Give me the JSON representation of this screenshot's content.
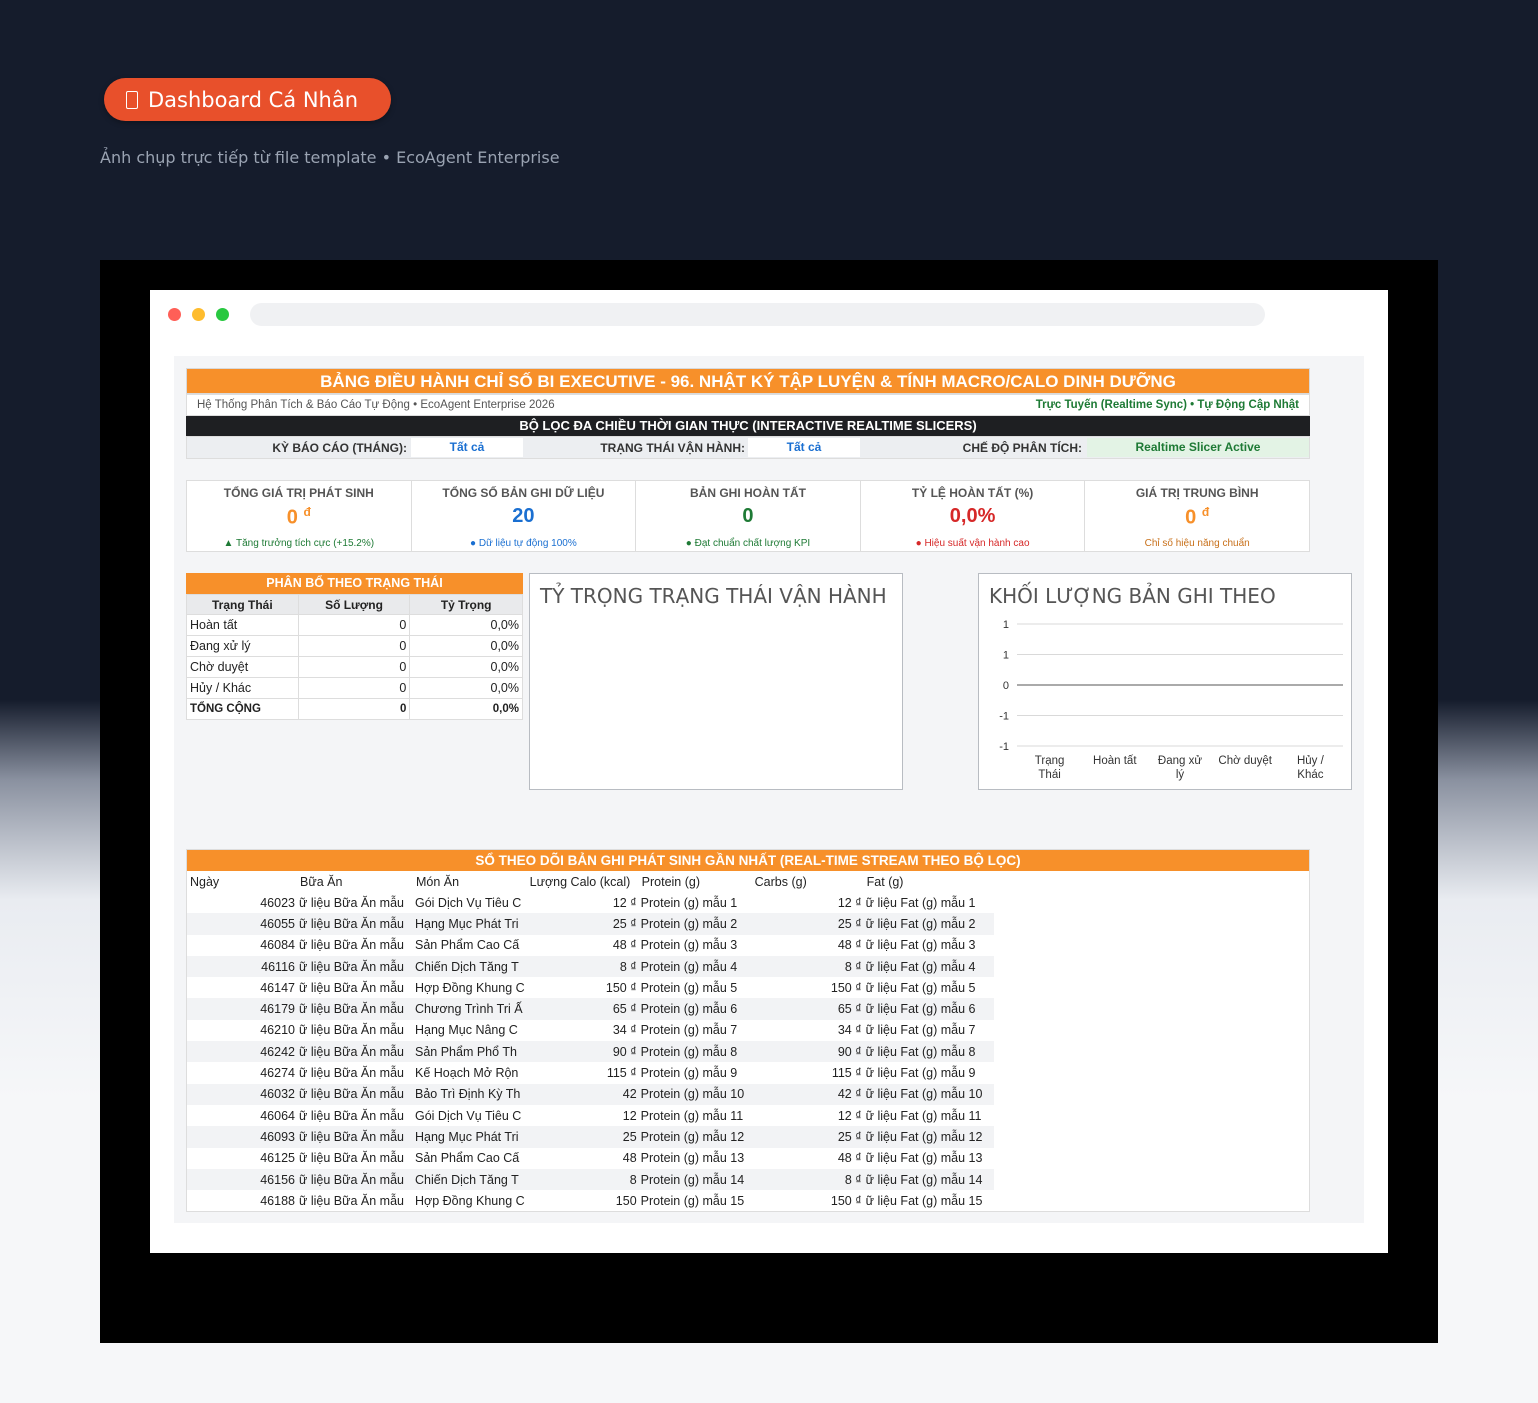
{
  "badge": {
    "icon": "document-icon",
    "label": "Dashboard Cá Nhân"
  },
  "subtitle": "Ảnh chụp trực tiếp từ file template • EcoAgent Enterprise",
  "sheet": {
    "title": "BẢNG ĐIỀU HÀNH CHỈ SỐ BI EXECUTIVE - 96. NHẬT KÝ TẬP LUYỆN & TÍNH MACRO/CALO DINH DƯỠNG",
    "info_left": "Hệ Thống Phân Tích & Báo Cáo Tự Động • EcoAgent Enterprise 2026",
    "info_right": "Trực Tuyến (Realtime Sync) • Tự Động Cập Nhật",
    "slicer_title": "BỘ LỌC ĐA CHIỀU THỜI GIAN THỰC (INTERACTIVE REALTIME SLICERS)",
    "slicers": {
      "period_label": "KỲ BÁO CÁO (THÁNG):",
      "period_value": "Tất cả",
      "status_label": "TRẠNG THÁI VẬN HÀNH:",
      "status_value": "Tất cả",
      "mode_label": "CHẾ ĐỘ PHÂN TÍCH:",
      "mode_value": "Realtime Slicer Active"
    },
    "kpis": [
      {
        "title": "TỔNG GIÁ TRỊ PHÁT SINH",
        "value": "0",
        "unit": "đ",
        "sub": "▲ Tăng trưởng tích cực (+15.2%)",
        "value_color": "#f7902a",
        "sub_color": "#1e7a35"
      },
      {
        "title": "TỔNG SỐ BẢN GHI DỮ LIỆU",
        "value": "20",
        "unit": "",
        "sub": "● Dữ liệu tự động 100%",
        "value_color": "#1a6fd1",
        "sub_color": "#1a6fd1"
      },
      {
        "title": "BẢN GHI HOÀN TẤT",
        "value": "0",
        "unit": "",
        "sub": "● Đạt chuẩn chất lượng KPI",
        "value_color": "#1e7a35",
        "sub_color": "#1e7a35"
      },
      {
        "title": "TỶ LỆ HOÀN TẤT (%)",
        "value": "0,0%",
        "unit": "",
        "sub": "● Hiệu suất vận hành cao",
        "value_color": "#d62828",
        "sub_color": "#d62828"
      },
      {
        "title": "GIÁ TRỊ TRUNG BÌNH",
        "value": "0",
        "unit": "đ",
        "sub": "Chỉ số hiệu năng chuẩn",
        "value_color": "#f7902a",
        "sub_color": "#c8701a"
      }
    ],
    "distribution": {
      "title": "PHÂN BỔ THEO TRẠNG THÁI",
      "headers": [
        "Trạng Thái",
        "Số Lượng",
        "Tỷ Trọng"
      ],
      "rows": [
        [
          "Hoàn tất",
          "0",
          "0,0%"
        ],
        [
          "Đang xử lý",
          "0",
          "0,0%"
        ],
        [
          "Chờ duyệt",
          "0",
          "0,0%"
        ],
        [
          "Hủy / Khác",
          "0",
          "0,0%"
        ]
      ],
      "total": [
        "TỔNG CỘNG",
        "0",
        "0,0%"
      ]
    },
    "pie_title": "TỶ TRỌNG TRẠNG THÁI VẬN HÀNH",
    "log": {
      "title": "SỔ THEO DÕI BẢN GHI PHÁT SINH GẦN NHẤT (REAL-TIME STREAM THEO BỘ LỌC)",
      "headers": [
        "Ngày",
        "Bữa Ăn",
        "Món Ăn",
        "Lượng Calo (kcal)",
        "Protein (g)",
        "Carbs (g)",
        "Fat (g)"
      ],
      "rows": [
        [
          "46023",
          "ữ liệu Bữa Ăn mẫu",
          "Gói Dịch Vụ Tiêu C",
          "12 ₫",
          "Protein (g) mẫu 1",
          "12 ₫",
          "ữ liệu Fat (g) mẫu 1"
        ],
        [
          "46055",
          "ữ liệu Bữa Ăn mẫu",
          "Hạng Mục Phát Tri",
          "25 ₫",
          "Protein (g) mẫu 2",
          "25 ₫",
          "ữ liệu Fat (g) mẫu 2"
        ],
        [
          "46084",
          "ữ liệu Bữa Ăn mẫu",
          "Sản Phẩm Cao Cấ",
          "48 ₫",
          "Protein (g) mẫu 3",
          "48 ₫",
          "ữ liệu Fat (g) mẫu 3"
        ],
        [
          "46116",
          "ữ liệu Bữa Ăn mẫu",
          "Chiến Dịch Tăng T",
          "8 ₫",
          "Protein (g) mẫu 4",
          "8 ₫",
          "ữ liệu Fat (g) mẫu 4"
        ],
        [
          "46147",
          "ữ liệu Bữa Ăn mẫu",
          "Hợp Đồng Khung C",
          "150 ₫",
          "Protein (g) mẫu 5",
          "150 ₫",
          "ữ liệu Fat (g) mẫu 5"
        ],
        [
          "46179",
          "ữ liệu Bữa Ăn mẫu",
          "Chương Trình Tri Ấ",
          "65 ₫",
          "Protein (g) mẫu 6",
          "65 ₫",
          "ữ liệu Fat (g) mẫu 6"
        ],
        [
          "46210",
          "ữ liệu Bữa Ăn mẫu",
          "Hạng Mục Nâng C",
          "34 ₫",
          "Protein (g) mẫu 7",
          "34 ₫",
          "ữ liệu Fat (g) mẫu 7"
        ],
        [
          "46242",
          "ữ liệu Bữa Ăn mẫu",
          "Sản Phẩm Phổ Th",
          "90 ₫",
          "Protein (g) mẫu 8",
          "90 ₫",
          "ữ liệu Fat (g) mẫu 8"
        ],
        [
          "46274",
          "ữ liệu Bữa Ăn mẫu",
          "Kế Hoạch Mở Rộn",
          "115 ₫",
          "Protein (g) mẫu 9",
          "115 ₫",
          "ữ liệu Fat (g) mẫu 9"
        ],
        [
          "46032",
          "ữ liệu Bữa Ăn mẫu",
          "Bảo Trì Định Kỳ Th",
          "42",
          "Protein (g) mẫu 10",
          "42 ₫",
          "ữ liệu Fat (g) mẫu 10"
        ],
        [
          "46064",
          "ữ liệu Bữa Ăn mẫu",
          "Gói Dịch Vụ Tiêu C",
          "12",
          "Protein (g) mẫu 11",
          "12 ₫",
          "ữ liệu Fat (g) mẫu 11"
        ],
        [
          "46093",
          "ữ liệu Bữa Ăn mẫu",
          "Hạng Mục Phát Tri",
          "25",
          "Protein (g) mẫu 12",
          "25 ₫",
          "ữ liệu Fat (g) mẫu 12"
        ],
        [
          "46125",
          "ữ liệu Bữa Ăn mẫu",
          "Sản Phẩm Cao Cấ",
          "48",
          "Protein (g) mẫu 13",
          "48 ₫",
          "ữ liệu Fat (g) mẫu 13"
        ],
        [
          "46156",
          "ữ liệu Bữa Ăn mẫu",
          "Chiến Dịch Tăng T",
          "8",
          "Protein (g) mẫu 14",
          "8 ₫",
          "ữ liệu Fat (g) mẫu 14"
        ],
        [
          "46188",
          "ữ liệu Bữa Ăn mẫu",
          "Hợp Đồng Khung C",
          "150",
          "Protein (g) mẫu 15",
          "150 ₫",
          "ữ liệu Fat (g) mẫu 15"
        ]
      ]
    }
  },
  "chart_data": {
    "type": "bar",
    "title": "KHỐI LƯỢNG BẢN GHI THEO",
    "categories": [
      "Trạng Thái",
      "Hoàn tất",
      "Đang xử lý",
      "Chờ duyệt",
      "Hủy / Khác"
    ],
    "values": [
      0,
      0,
      0,
      0,
      0
    ],
    "ytick_labels": [
      "1",
      "1",
      "0",
      "-1",
      "-1"
    ],
    "ylim": [
      -1,
      1
    ],
    "grid": true,
    "xlabel": "",
    "ylabel": ""
  }
}
